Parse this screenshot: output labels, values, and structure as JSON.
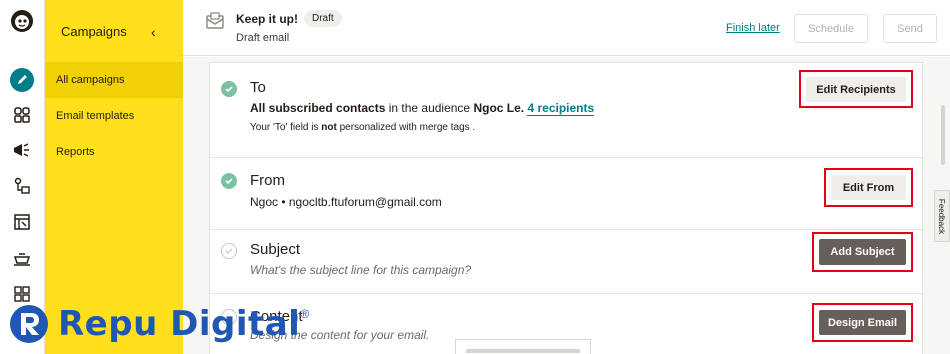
{
  "sidebar": {
    "title": "Campaigns",
    "collapse_glyph": "‹",
    "items": [
      {
        "label": "All campaigns",
        "active": true
      },
      {
        "label": "Email templates",
        "active": false
      },
      {
        "label": "Reports",
        "active": false
      }
    ]
  },
  "rail_icons": [
    "mailchimp-logo",
    "pencil-icon",
    "audience-icon",
    "campaigns-icon",
    "automations-icon",
    "website-icon",
    "content-icon",
    "integrations-icon"
  ],
  "topbar": {
    "title": "Keep it up!",
    "badge": "Draft",
    "subtitle": "Draft email",
    "finish_later": "Finish later",
    "schedule": "Schedule",
    "send": "Send"
  },
  "sections": {
    "to": {
      "title": "To",
      "line_bold": "All subscribed contacts",
      "line_mid": " in the audience ",
      "audience": "Ngoc Le.",
      "recipients": "4 recipients",
      "note_a": "Your 'To' field is ",
      "note_b": "not",
      "note_c": " personalized with merge tags .",
      "button": "Edit Recipients"
    },
    "from": {
      "title": "From",
      "line": "Ngoc • ngocltb.ftuforum@gmail.com",
      "button": "Edit From"
    },
    "subject": {
      "title": "Subject",
      "hint": "What's the subject line for this campaign?",
      "button": "Add Subject"
    },
    "content": {
      "title": "Content",
      "hint": "Design the content for your email.",
      "button": "Design Email"
    }
  },
  "feedback": "Feedback",
  "watermark": {
    "text": "Repu Digital",
    "mark": "®"
  },
  "colors": {
    "sidebar": "#ffe01b",
    "link": "#007c89",
    "check": "#7cc1a1",
    "highlight": "#e5001a",
    "watermark": "#1f57b3"
  }
}
